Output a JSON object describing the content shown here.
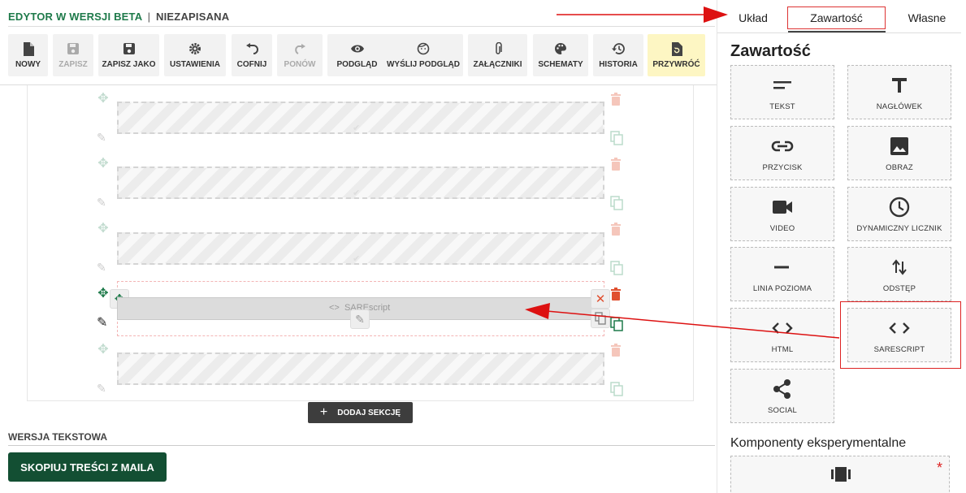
{
  "editor": {
    "beta_label": "EDYTOR W WERSJI BETA",
    "separator": "|",
    "state_label": "NIEZAPISANA"
  },
  "toolbar": {
    "buttons": [
      {
        "label": "NOWY",
        "icon": "file-icon"
      },
      {
        "label": "ZAPISZ",
        "icon": "save-icon",
        "disabled": true
      },
      {
        "label": "ZAPISZ JAKO",
        "icon": "save-as-icon"
      },
      {
        "label": "USTAWIENIA",
        "icon": "gear-icon"
      },
      {
        "label": "COFNIJ",
        "icon": "undo-icon"
      },
      {
        "label": "PONÓW",
        "icon": "redo-icon",
        "disabled": true
      },
      {
        "label": "PODGLĄD",
        "icon": "eye-icon"
      },
      {
        "label": "WYŚLIJ PODGLĄD",
        "icon": "face-icon"
      },
      {
        "label": "ZAŁĄCZNIKI",
        "icon": "paperclip-icon"
      },
      {
        "label": "SCHEMATY",
        "icon": "palette-icon"
      },
      {
        "label": "HISTORIA",
        "icon": "history-icon"
      },
      {
        "label": "PRZYWRÓĆ",
        "icon": "restore-icon",
        "highlight": true
      }
    ]
  },
  "canvas": {
    "active_block_label": "SAREscript",
    "add_section_label": "DODAJ SEKCJĘ"
  },
  "text_version": {
    "heading": "WERSJA TEKSTOWA",
    "copy_button": "SKOPIUJ TREŚCI Z MAILA"
  },
  "panel": {
    "tabs": [
      {
        "label": "Układ"
      },
      {
        "label": "Zawartość",
        "active": true
      },
      {
        "label": "Własne"
      }
    ],
    "title": "Zawartość",
    "tiles": [
      {
        "label": "TEKST",
        "icon": "text-lines-icon"
      },
      {
        "label": "NAGŁÓWEK",
        "icon": "heading-t-icon"
      },
      {
        "label": "PRZYCISK",
        "icon": "link-icon"
      },
      {
        "label": "OBRAZ",
        "icon": "image-icon"
      },
      {
        "label": "VIDEO",
        "icon": "video-camera-icon"
      },
      {
        "label": "DYNAMICZNY LICZNIK",
        "icon": "clock-icon"
      },
      {
        "label": "LINIA POZIOMA",
        "icon": "horizontal-line-icon"
      },
      {
        "label": "ODSTĘP",
        "icon": "spacing-arrows-icon"
      },
      {
        "label": "HTML",
        "icon": "code-icon"
      },
      {
        "label": "SARESCRIPT",
        "icon": "code-icon"
      },
      {
        "label": "SOCIAL",
        "icon": "share-icon"
      }
    ],
    "experimental_title": "Komponenty eksperymentalne",
    "experimental_star": "*"
  },
  "colors": {
    "brand_green": "#1e7a4a",
    "dark_green_button": "#134f33",
    "highlight_yellow": "#fdf6c3",
    "annotation_red": "#dd1111"
  }
}
